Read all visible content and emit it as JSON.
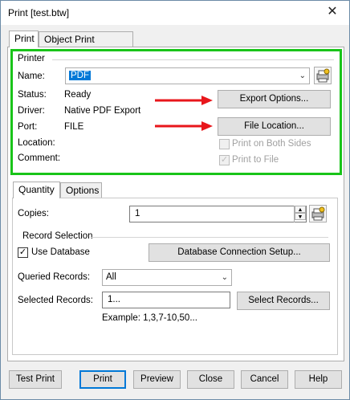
{
  "window": {
    "title": "Print [test.btw]",
    "close_glyph": "✕"
  },
  "tabs": [
    "Print",
    "Object Print Method"
  ],
  "printer": {
    "group_label": "Printer",
    "name_label": "Name:",
    "name_value": "PDF",
    "status_label": "Status:",
    "status_value": "Ready",
    "driver_label": "Driver:",
    "driver_value": "Native PDF Export",
    "port_label": "Port:",
    "port_value": "FILE",
    "location_label": "Location:",
    "comment_label": "Comment:",
    "export_options": "Export Options...",
    "file_location": "File Location...",
    "print_both_sides": "Print on Both Sides",
    "print_to_file": "Print to File"
  },
  "subtabs": [
    "Quantity",
    "Options"
  ],
  "quantity": {
    "copies_label": "Copies:",
    "copies_value": "1",
    "record_selection_label": "Record Selection",
    "use_database": "Use Database",
    "db_setup": "Database Connection Setup...",
    "queried_label": "Queried Records:",
    "queried_value": "All",
    "selected_label": "Selected Records:",
    "selected_value": "1...",
    "select_records": "Select Records...",
    "example": "Example: 1,3,7-10,50..."
  },
  "footer": {
    "test_print": "Test Print",
    "print": "Print",
    "preview": "Preview",
    "close": "Close",
    "cancel": "Cancel",
    "help": "Help"
  },
  "colors": {
    "highlight": "#19c419",
    "arrow": "#e8161b",
    "focus": "#0078d7"
  },
  "icons": [
    "printer-properties-icon",
    "copies-settings-icon",
    "close-icon",
    "chevron-down-icon",
    "red-arrow-icon",
    "checkmark-icon"
  ]
}
